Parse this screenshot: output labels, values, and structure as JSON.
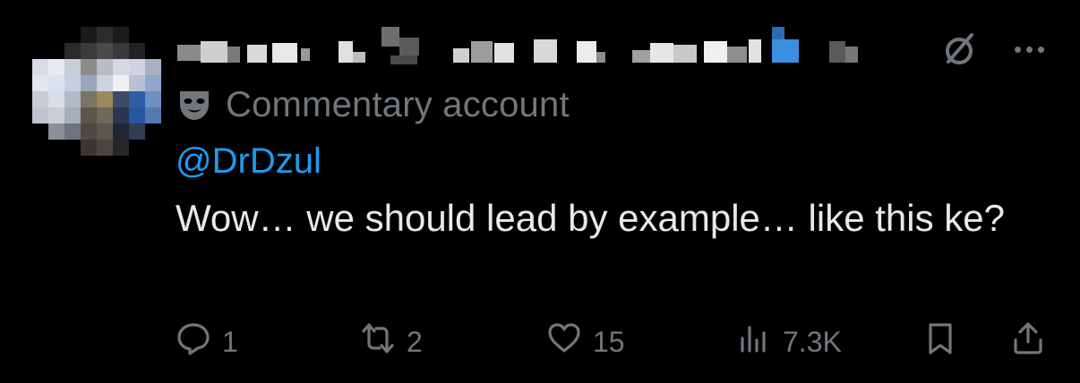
{
  "post": {
    "label": "Commentary account",
    "mention": "@DrDzul",
    "text": "Wow… we should lead by example… like this ke?"
  },
  "actions": {
    "replies": "1",
    "reposts": "2",
    "likes": "15",
    "views": "7.3K"
  },
  "icons": {
    "label": "mask-icon",
    "top": [
      "grok-icon",
      "more-icon"
    ],
    "actions": [
      "reply-icon",
      "repost-icon",
      "like-icon",
      "views-icon",
      "bookmark-icon",
      "share-icon"
    ]
  },
  "colors": {
    "background": "#000000",
    "text": "#e7e9ea",
    "muted": "#71767b",
    "link": "#1d9bf0"
  }
}
